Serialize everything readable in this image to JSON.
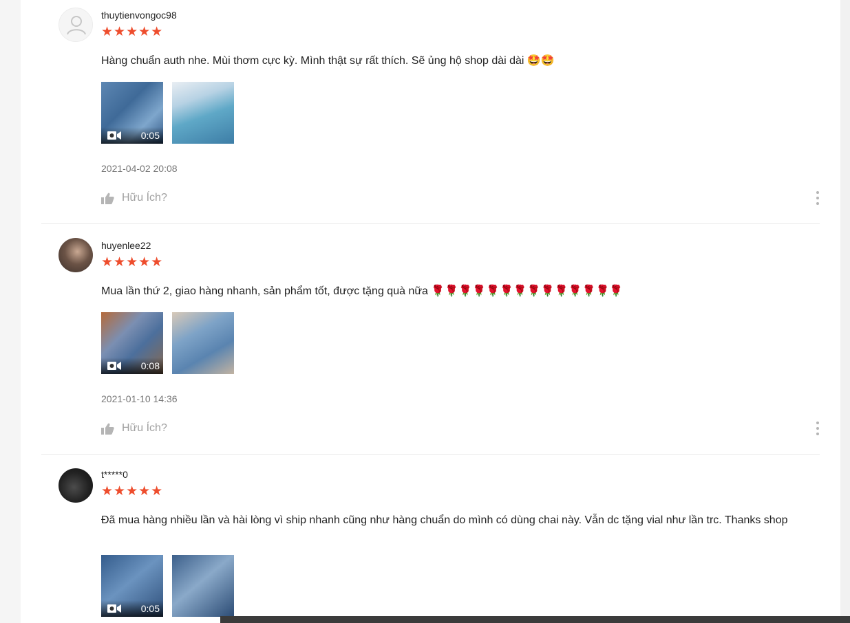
{
  "reviews": [
    {
      "username": "thuytienvongoc98",
      "stars": "★★★★★",
      "comment": "Hàng chuẩn auth nhe. Mùi thơm cực kỳ. Mình thật sự rất thích. Sẽ ủng hộ shop dài dài 🤩🤩",
      "video_duration": "0:05",
      "date": "2021-04-02 20:08",
      "helpful_label": "Hữu Ích?"
    },
    {
      "username": "huyenlee22",
      "stars": "★★★★★",
      "comment": "Mua lần thứ 2, giao hàng nhanh, sản phẩm tốt, được tặng quà nữa 🌹🌹🌹🌹🌹🌹🌹🌹🌹🌹🌹🌹🌹🌹",
      "video_duration": "0:08",
      "date": "2021-01-10 14:36",
      "helpful_label": "Hữu Ích?"
    },
    {
      "username": "t*****0",
      "stars": "★★★★★",
      "comment": "Đã mua hàng nhiều lần và hài lòng vì ship nhanh cũng như hàng chuẩn do mình có dùng chai này. Vẫn dc tặng vial như lần trc. Thanks shop",
      "video_duration": "0:05"
    }
  ],
  "colors": {
    "star": "#ee4d2d",
    "muted_text": "#757575",
    "helpful_text": "#a0a0a0"
  },
  "icons": [
    "default-avatar-icon",
    "video-camera-icon",
    "thumbs-up-icon",
    "more-vertical-icon"
  ]
}
